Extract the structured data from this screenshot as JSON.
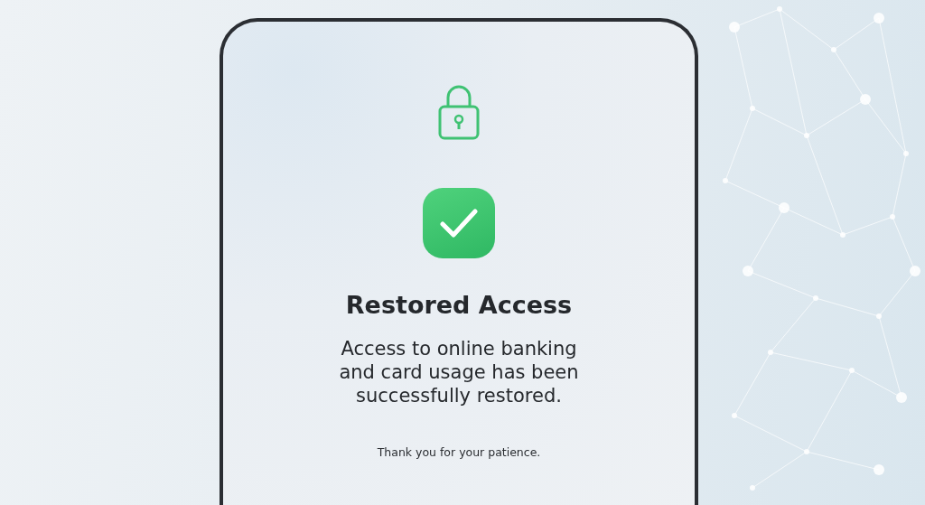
{
  "screen": {
    "title": "Restored Access",
    "message": "Access to online banking and card usage has been successfully restored.",
    "footer": "Thank you for your patience."
  }
}
